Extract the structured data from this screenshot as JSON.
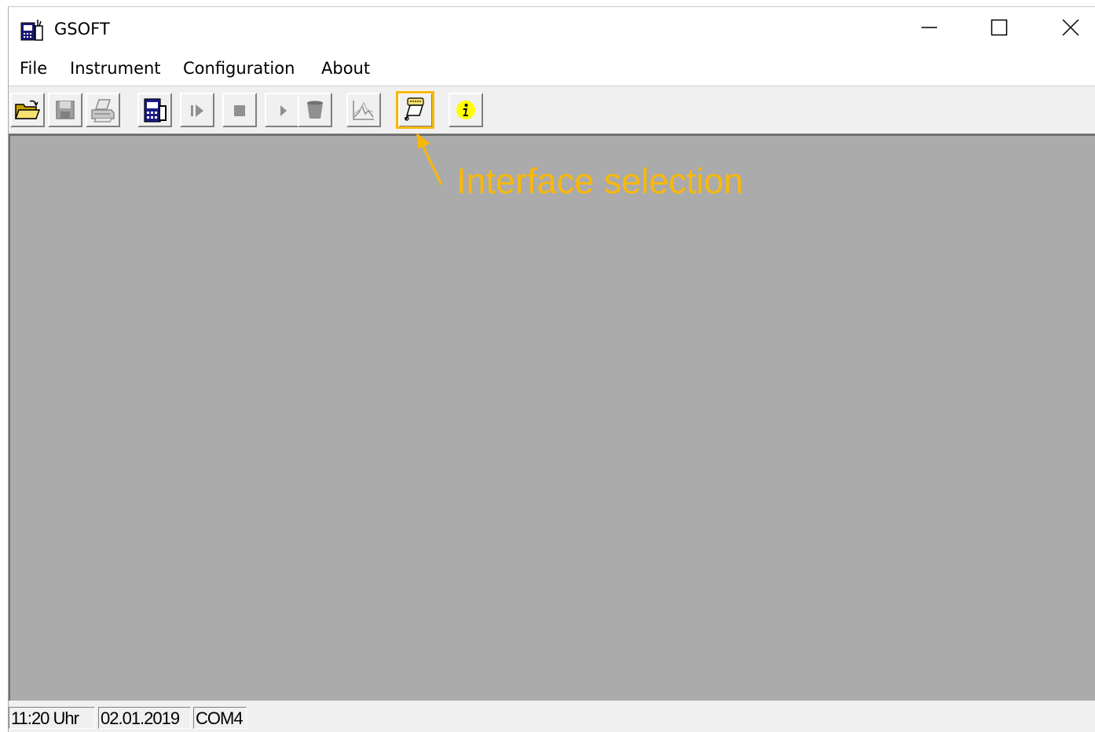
{
  "window": {
    "title": "GSOFT"
  },
  "caption_buttons": [
    "minimize-icon",
    "maximize-icon",
    "close-icon"
  ],
  "menu": [
    {
      "label": "File"
    },
    {
      "label": "Instrument"
    },
    {
      "label": "Configuration"
    },
    {
      "label": "About"
    }
  ],
  "toolbar": {
    "buttons": [
      {
        "icon": "open-folder-icon",
        "enabled": true
      },
      {
        "icon": "save-icon",
        "enabled": false
      },
      {
        "icon": "print-icon",
        "enabled": false
      },
      {
        "icon": "instrument-icon",
        "enabled": true
      },
      {
        "icon": "step-forward-icon",
        "enabled": false
      },
      {
        "icon": "stop-icon",
        "enabled": false
      },
      {
        "icon": "play-icon",
        "enabled": false
      },
      {
        "icon": "bucket-icon",
        "enabled": false
      },
      {
        "icon": "graph-icon",
        "enabled": false
      },
      {
        "icon": "interface-selection-icon",
        "enabled": true,
        "highlighted": true
      },
      {
        "icon": "info-icon",
        "enabled": true
      }
    ]
  },
  "annotation": {
    "text": "Interface selection",
    "color": "#f8b80a"
  },
  "status": {
    "time": "11:20 Uhr",
    "date": "02.01.2019",
    "port": "COM4"
  }
}
